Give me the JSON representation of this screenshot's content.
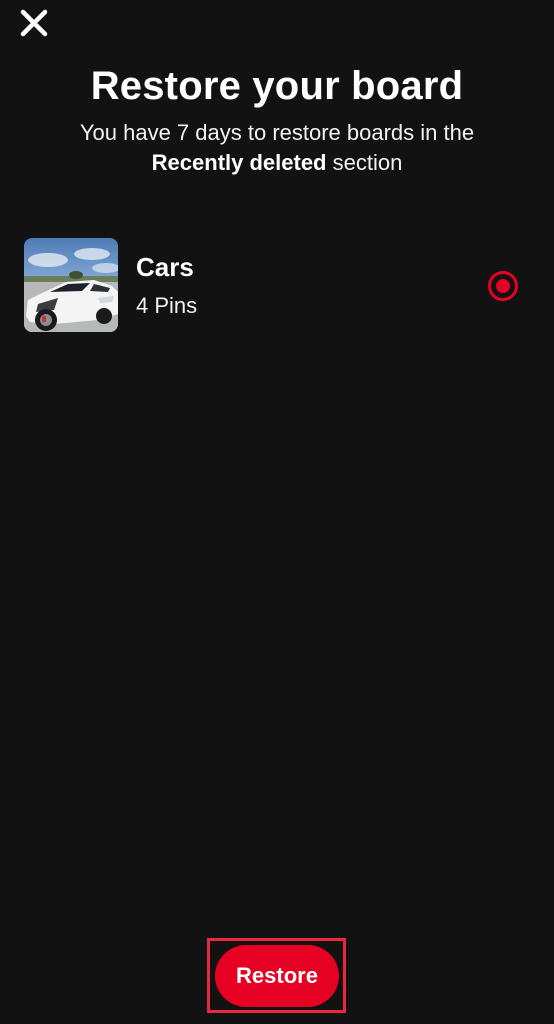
{
  "header": {
    "close_icon": "close-icon",
    "title": "Restore your board",
    "subtitle_prefix": "You have 7 days to restore boards in the",
    "subtitle_bold": "Recently deleted",
    "subtitle_suffix": " section"
  },
  "boards": [
    {
      "name": "Cars",
      "pins": "4 Pins",
      "thumbnail": "white-sports-car-image",
      "selected": true
    }
  ],
  "footer": {
    "restore_label": "Restore"
  },
  "colors": {
    "background": "#121212",
    "accent": "#e60023",
    "text": "#ffffff"
  }
}
